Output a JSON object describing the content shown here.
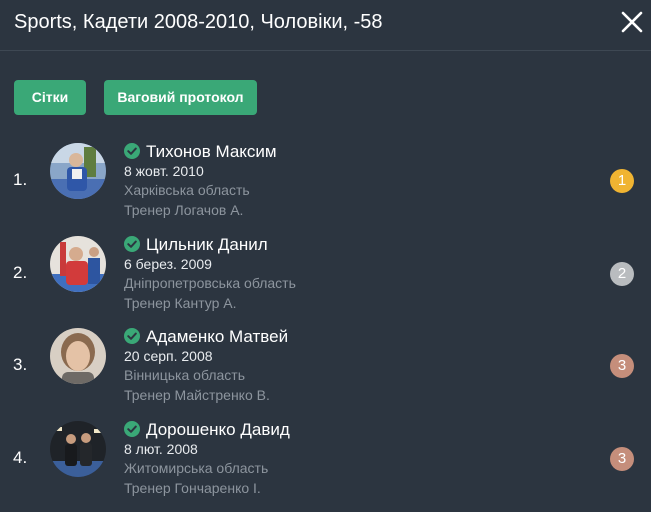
{
  "header": {
    "title": "Sports, Кадети 2008-2010, Чоловіки, -58",
    "close_icon": "close-icon"
  },
  "buttons": {
    "grids": "Сітки",
    "weight_protocol": "Ваговий протокол"
  },
  "colors": {
    "background": "#2c3540",
    "button": "#3aa877",
    "check": "#3aa877",
    "gold": "#f0b432",
    "silver": "#b9bcbf",
    "bronze": "#c58e7b"
  },
  "athletes": [
    {
      "number": "1.",
      "name": "Тихонов Максим",
      "dob": "8 жовт. 2010",
      "region": "Харківська область",
      "coach": "Тренер Логачов А.",
      "place": "1",
      "medal": "gold",
      "verified": true
    },
    {
      "number": "2.",
      "name": "Цильник Данил",
      "dob": "6 берез. 2009",
      "region": "Дніпропетровська область",
      "coach": "Тренер Кантур А.",
      "place": "2",
      "medal": "silver",
      "verified": true
    },
    {
      "number": "3.",
      "name": "Адаменко Матвей",
      "dob": "20 серп. 2008",
      "region": "Вінницька область",
      "coach": "Тренер Майстренко В.",
      "place": "3",
      "medal": "bronze",
      "verified": true
    },
    {
      "number": "4.",
      "name": "Дорошенко Давид",
      "dob": "8 лют. 2008",
      "region": "Житомирська область",
      "coach": "Тренер Гончаренко І.",
      "place": "3",
      "medal": "bronze",
      "verified": true
    }
  ]
}
